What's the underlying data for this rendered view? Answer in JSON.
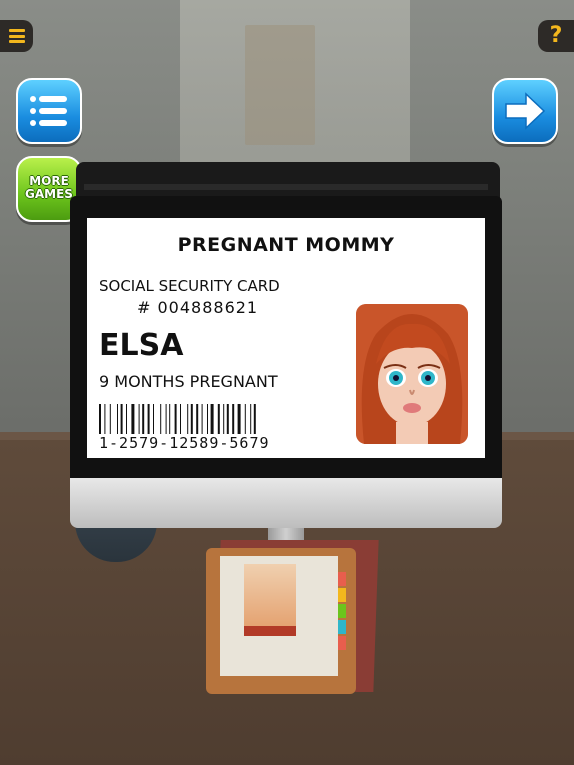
{
  "toolbar": {
    "menu_icon": "hamburger-menu-icon",
    "help_label": "?",
    "list_icon": "list-icon",
    "next_icon": "arrow-right-icon",
    "more_games_line1": "MORE",
    "more_games_line2": "GAMES"
  },
  "id_card": {
    "title": "PREGNANT MOMMY",
    "card_type": "SOCIAL SECURITY CARD",
    "number": "# 004888621",
    "name": "ELSA",
    "status": "9 MONTHS PREGNANT",
    "barcode_number": "1-2579-12589-5679"
  },
  "colors": {
    "accent_yellow": "#f3b71d",
    "button_blue": "#1a8de0",
    "button_green": "#6cc41c"
  }
}
